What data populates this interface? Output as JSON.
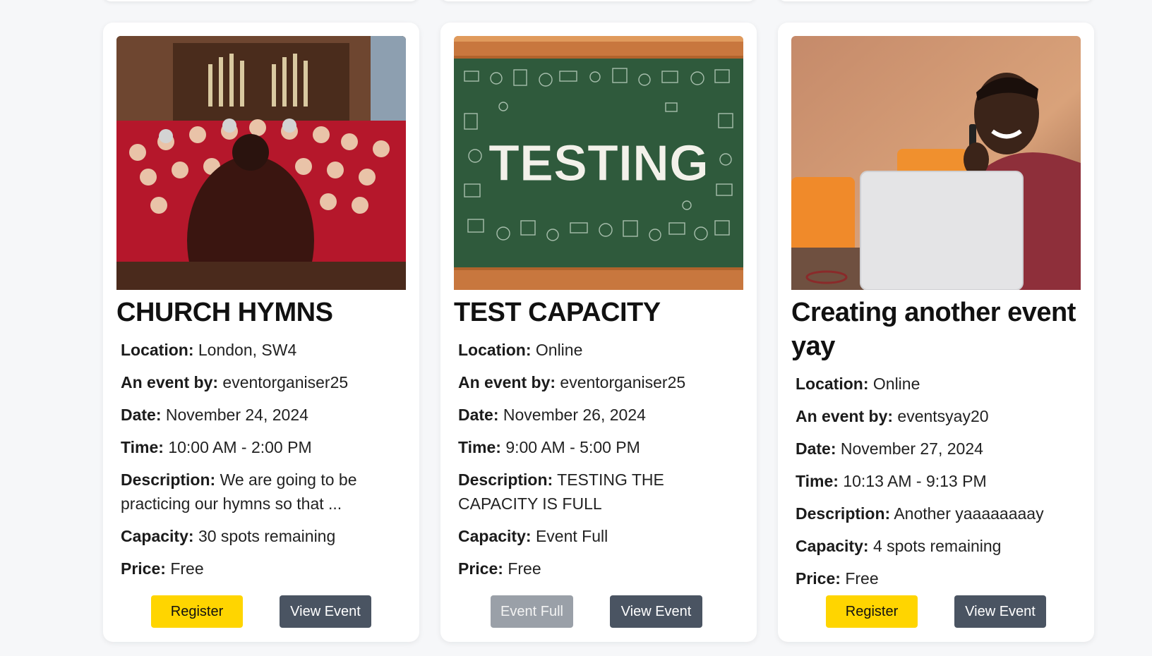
{
  "cards": [
    {
      "title": "CHURCH HYMNS",
      "location_label": "Location:",
      "location": "London, SW4",
      "organiser_label": "An event by:",
      "organiser": "eventorganiser25",
      "date_label": "Date:",
      "date": "November 24, 2024",
      "time_label": "Time:",
      "time": "10:00 AM - 2:00 PM",
      "description_label": "Description:",
      "description": "We are going to be practicing our hymns so that ...",
      "capacity_label": "Capacity:",
      "capacity": "30 spots remaining",
      "price_label": "Price:",
      "price": "Free",
      "primary_button": "Register",
      "view_button": "View Event"
    },
    {
      "title": "TEST CAPACITY",
      "image_text": "TESTING",
      "location_label": "Location:",
      "location": "Online",
      "organiser_label": "An event by:",
      "organiser": "eventorganiser25",
      "date_label": "Date:",
      "date": "November 26, 2024",
      "time_label": "Time:",
      "time": "9:00 AM - 5:00 PM",
      "description_label": "Description:",
      "description": "TESTING THE CAPACITY IS FULL",
      "capacity_label": "Capacity:",
      "capacity": "Event Full",
      "price_label": "Price:",
      "price": "Free",
      "primary_button": "Event Full",
      "view_button": "View Event"
    },
    {
      "title": "Creating another event yay",
      "location_label": "Location:",
      "location": "Online",
      "organiser_label": "An event by:",
      "organiser": "eventsyay20",
      "date_label": "Date:",
      "date": "November 27, 2024",
      "time_label": "Time:",
      "time": "10:13 AM - 9:13 PM",
      "description_label": "Description:",
      "description": "Another yaaaaaaaay",
      "capacity_label": "Capacity:",
      "capacity": "4 spots remaining",
      "price_label": "Price:",
      "price": "Free",
      "primary_button": "Register",
      "view_button": "View Event"
    }
  ],
  "colors": {
    "register": "#ffd500",
    "view": "#4a5462",
    "event_full": "#9aa0a8",
    "background": "#f6f7f9"
  }
}
